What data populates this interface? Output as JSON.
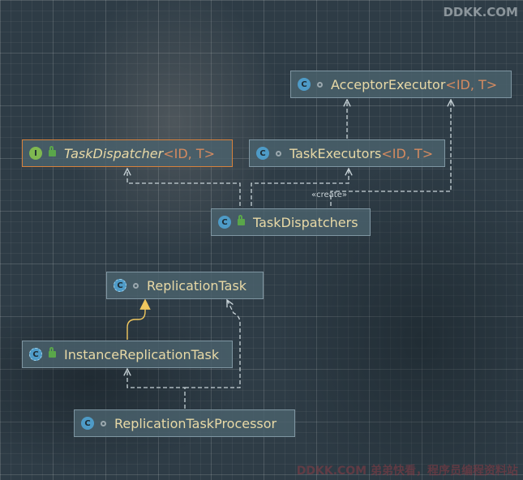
{
  "watermark_top": "DDKK.COM",
  "watermark_bottom": "DDKK.COM 弟弟快看，程序员编程资料站",
  "colors": {
    "border": "#7f96a2",
    "selected_border": "#d8823c",
    "class_name": "#e8d9a6",
    "type_param": "#d48a60",
    "edge_dashed": "#c8d3d8",
    "edge_inherit": "#f0c75e"
  },
  "nodes": [
    {
      "id": "acceptor_executor",
      "kind": "class",
      "icon": "class-icon",
      "visibility": "package-private-icon",
      "name": "AcceptorExecutor",
      "type_params": "<ID, T>"
    },
    {
      "id": "task_dispatcher",
      "kind": "interface",
      "icon": "interface-icon",
      "visibility": "public-lock-icon",
      "name": "TaskDispatcher",
      "type_params": "<ID, T>",
      "selected": true
    },
    {
      "id": "task_executors",
      "kind": "class",
      "icon": "class-icon",
      "visibility": "package-private-icon",
      "name": "TaskExecutors",
      "type_params": "<ID, T>"
    },
    {
      "id": "task_dispatchers",
      "kind": "class",
      "icon": "class-icon",
      "visibility": "public-lock-icon",
      "name": "TaskDispatchers",
      "type_params": ""
    },
    {
      "id": "replication_task",
      "kind": "abstract-class",
      "icon": "abstract-class-icon",
      "visibility": "package-private-icon",
      "name": "ReplicationTask",
      "type_params": ""
    },
    {
      "id": "instance_replication_task",
      "kind": "abstract-class",
      "icon": "abstract-class-icon",
      "visibility": "public-lock-icon",
      "name": "InstanceReplicationTask",
      "type_params": ""
    },
    {
      "id": "replication_task_processor",
      "kind": "class",
      "icon": "class-icon",
      "visibility": "package-private-icon",
      "name": "ReplicationTaskProcessor",
      "type_params": ""
    }
  ],
  "edges": [
    {
      "from": "task_dispatchers",
      "to": "task_dispatcher",
      "kind": "dependency"
    },
    {
      "from": "task_dispatchers",
      "to": "task_executors",
      "kind": "dependency"
    },
    {
      "from": "task_dispatchers",
      "to": "acceptor_executor",
      "kind": "create",
      "label": "«create»"
    },
    {
      "from": "task_executors",
      "to": "acceptor_executor",
      "kind": "dependency"
    },
    {
      "from": "instance_replication_task",
      "to": "replication_task",
      "kind": "inheritance"
    },
    {
      "from": "replication_task_processor",
      "to": "instance_replication_task",
      "kind": "dependency"
    },
    {
      "from": "replication_task_processor",
      "to": "replication_task",
      "kind": "dependency"
    }
  ]
}
